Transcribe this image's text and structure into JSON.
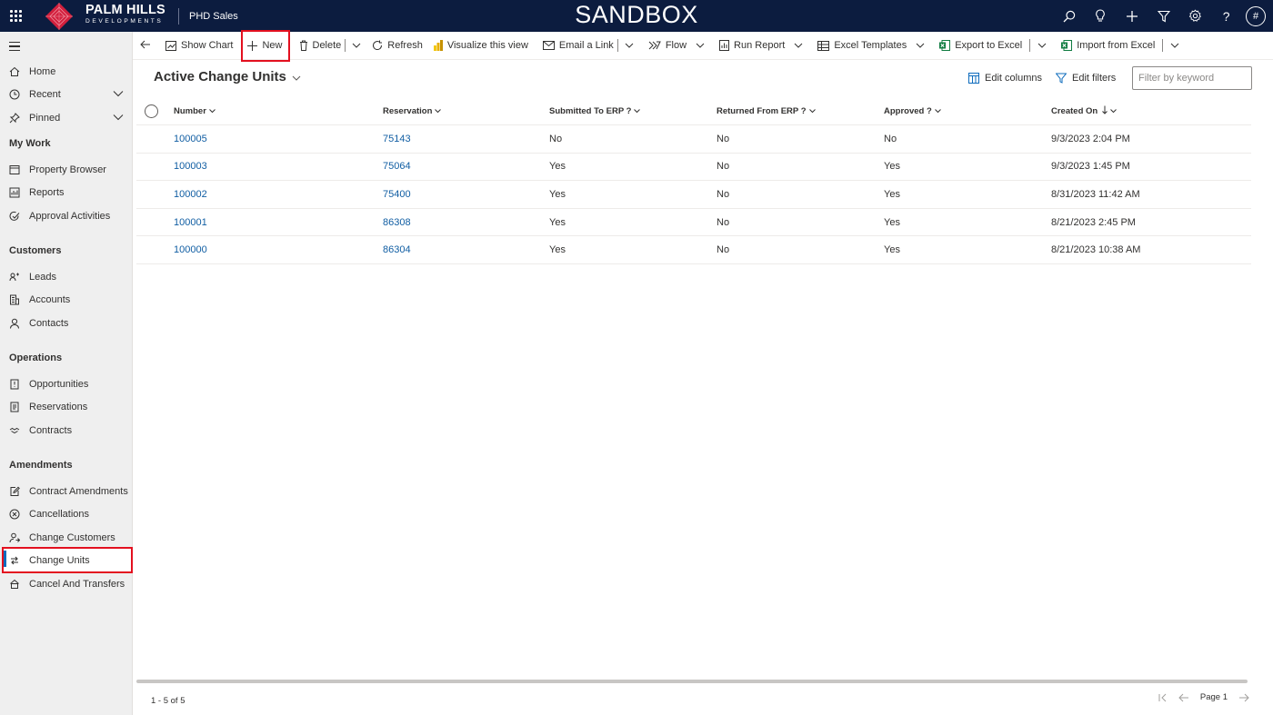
{
  "topbar": {
    "logo_line1": "PALM HILLS",
    "logo_line2": "DEVELOPMENTS",
    "app_name": "PHD Sales",
    "environment": "SANDBOX",
    "icons": [
      "search-icon",
      "lightbulb-icon",
      "plus-icon",
      "filter-icon",
      "gear-icon",
      "help-icon"
    ],
    "avatar_initial": "#",
    "bg_color": "#0c1c3f",
    "logo_color": "#d2203d"
  },
  "sidebar": {
    "top": [
      {
        "label": "Home",
        "icon": "home-icon"
      },
      {
        "label": "Recent",
        "icon": "clock-icon",
        "expandable": true
      },
      {
        "label": "Pinned",
        "icon": "pin-icon",
        "expandable": true
      }
    ],
    "sections": [
      {
        "header": "My Work",
        "items": [
          {
            "label": "Property Browser",
            "icon": "browser-icon"
          },
          {
            "label": "Reports",
            "icon": "report-icon"
          },
          {
            "label": "Approval Activities",
            "icon": "approval-icon"
          }
        ]
      },
      {
        "header": "Customers",
        "items": [
          {
            "label": "Leads",
            "icon": "leads-icon"
          },
          {
            "label": "Accounts",
            "icon": "building-icon"
          },
          {
            "label": "Contacts",
            "icon": "person-icon"
          }
        ]
      },
      {
        "header": "Operations",
        "items": [
          {
            "label": "Opportunities",
            "icon": "opportunity-icon"
          },
          {
            "label": "Reservations",
            "icon": "reservation-icon"
          },
          {
            "label": "Contracts",
            "icon": "handshake-icon"
          }
        ]
      },
      {
        "header": "Amendments",
        "items": [
          {
            "label": "Contract Amendments",
            "icon": "edit-doc-icon"
          },
          {
            "label": "Cancellations",
            "icon": "cancel-circle-icon"
          },
          {
            "label": "Change Customers",
            "icon": "person-swap-icon"
          },
          {
            "label": "Change Units",
            "icon": "swap-icon",
            "selected": true
          },
          {
            "label": "Cancel And Transfers",
            "icon": "transfer-icon"
          }
        ]
      }
    ]
  },
  "commandbar": {
    "show_chart": "Show Chart",
    "new": "New",
    "delete": "Delete",
    "refresh": "Refresh",
    "visualize": "Visualize this view",
    "email_link": "Email a Link",
    "flow": "Flow",
    "run_report": "Run Report",
    "excel_templates": "Excel Templates",
    "export_excel": "Export to Excel",
    "import_excel": "Import from Excel"
  },
  "view": {
    "title": "Active Change Units",
    "edit_columns": "Edit columns",
    "edit_filters": "Edit filters",
    "filter_placeholder": "Filter by keyword"
  },
  "grid": {
    "columns": [
      "Number",
      "Reservation",
      "Submitted To ERP ?",
      "Returned From ERP ?",
      "Approved ?",
      "Created On"
    ],
    "rows": [
      {
        "number": "100005",
        "reservation": "75143",
        "submitted": "No",
        "returned": "No",
        "approved": "No",
        "created": "9/3/2023 2:04 PM"
      },
      {
        "number": "100003",
        "reservation": "75064",
        "submitted": "Yes",
        "returned": "No",
        "approved": "Yes",
        "created": "9/3/2023 1:45 PM"
      },
      {
        "number": "100002",
        "reservation": "75400",
        "submitted": "Yes",
        "returned": "No",
        "approved": "Yes",
        "created": "8/31/2023 11:42 AM"
      },
      {
        "number": "100001",
        "reservation": "86308",
        "submitted": "Yes",
        "returned": "No",
        "approved": "Yes",
        "created": "8/21/2023 2:45 PM"
      },
      {
        "number": "100000",
        "reservation": "86304",
        "submitted": "Yes",
        "returned": "No",
        "approved": "Yes",
        "created": "8/21/2023 10:38 AM"
      }
    ]
  },
  "footer": {
    "count": "1 - 5 of 5",
    "page": "Page 1"
  },
  "colors": {
    "link": "#115ea3",
    "highlight": "#e3101f",
    "excel_green": "#107c41"
  }
}
